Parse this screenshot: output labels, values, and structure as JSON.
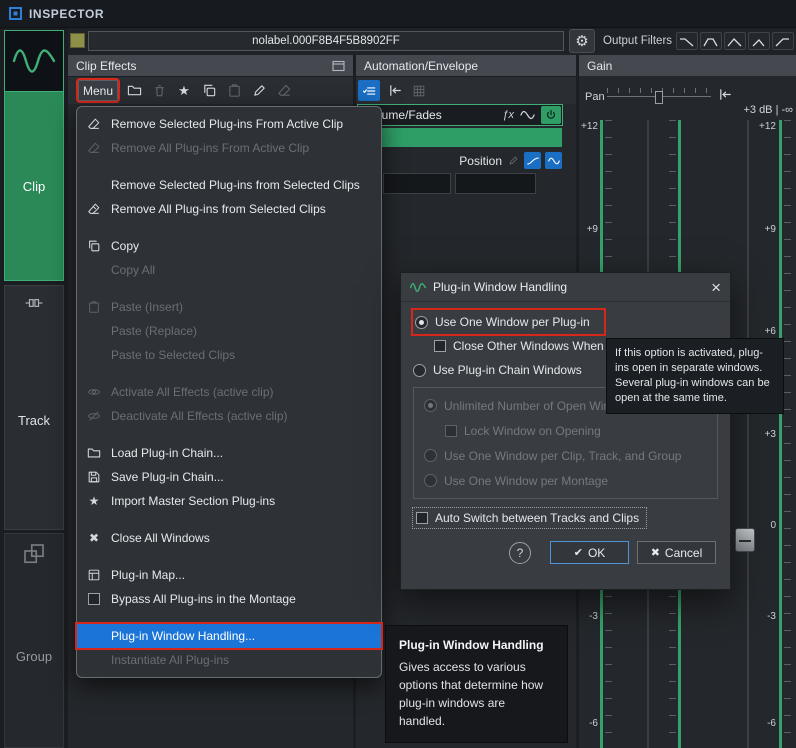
{
  "titlebar": {
    "title": "INSPECTOR"
  },
  "sidebar": {
    "clip_label": "Clip",
    "track_label": "Track",
    "group_label": "Group"
  },
  "header": {
    "clip_name": "nolabel.000F8B4F5B8902FF",
    "output_filters_label": "Output Filters"
  },
  "clip_effects": {
    "title": "Clip Effects",
    "menu_button_label": "Menu"
  },
  "automation": {
    "title": "Automation/Envelope",
    "curve_selector": "Volume/Fades",
    "position_label": "Position"
  },
  "gain": {
    "title": "Gain",
    "pan_label": "Pan",
    "level_readout": "+3 dB | -∞",
    "scale": [
      "+12",
      "+9",
      "+6",
      "+3",
      "0",
      "-3",
      "-6"
    ]
  },
  "menu": {
    "items": [
      {
        "label": "Remove Selected Plug-ins From Active Clip",
        "enabled": true
      },
      {
        "label": "Remove All Plug-ins From Active Clip",
        "enabled": false
      },
      {
        "label": "Remove Selected Plug-ins from Selected Clips",
        "enabled": true
      },
      {
        "label": "Remove All Plug-ins from Selected Clips",
        "enabled": true
      },
      {
        "label": "Copy",
        "enabled": true
      },
      {
        "label": "Copy All",
        "enabled": false
      },
      {
        "label": "Paste (Insert)",
        "enabled": false
      },
      {
        "label": "Paste (Replace)",
        "enabled": false
      },
      {
        "label": "Paste to Selected Clips",
        "enabled": false
      },
      {
        "label": "Activate All Effects (active clip)",
        "enabled": false
      },
      {
        "label": "Deactivate All Effects (active clip)",
        "enabled": false
      },
      {
        "label": "Load Plug-in Chain...",
        "enabled": true
      },
      {
        "label": "Save Plug-in Chain...",
        "enabled": true
      },
      {
        "label": "Import Master Section Plug-ins",
        "enabled": true
      },
      {
        "label": "Close All Windows",
        "enabled": true
      },
      {
        "label": "Plug-in Map...",
        "enabled": true
      },
      {
        "label": "Bypass All Plug-ins in the Montage",
        "enabled": true
      },
      {
        "label": "Plug-in Window Handling...",
        "enabled": true,
        "highlighted": true
      },
      {
        "label": "Instantiate All Plug-ins",
        "enabled": false
      }
    ]
  },
  "dialog": {
    "title": "Plug-in Window Handling",
    "radio_one_window_per_plugin": "Use One Window per Plug-in",
    "check_close_other": "Close Other Windows When Opening a New One",
    "radio_chain_windows": "Use Plug-in Chain Windows",
    "radio_unlimited": "Unlimited Number of Open Windows",
    "check_lock": "Lock Window on Opening",
    "radio_per_clip_track_group": "Use One Window per Clip, Track, and Group",
    "radio_per_montage": "Use One Window per Montage",
    "check_auto_switch": "Auto Switch between Tracks and Clips",
    "ok_label": "OK",
    "cancel_label": "Cancel"
  },
  "tooltips": {
    "radio_tooltip": "If this option is activated, plug-ins open in separate windows. Several plug-in windows can be open at the same time.",
    "menu_tooltip_title": "Plug-in Window Handling",
    "menu_tooltip_body": "Gives access to various options that determine how plug-in windows are handled."
  },
  "icons": {
    "gear": "⚙",
    "star": "★",
    "close_menu": "✖",
    "dialog_close": "×",
    "ok_check": "✔",
    "cancel_cross": "✖",
    "help": "?",
    "fx": "ƒx"
  }
}
